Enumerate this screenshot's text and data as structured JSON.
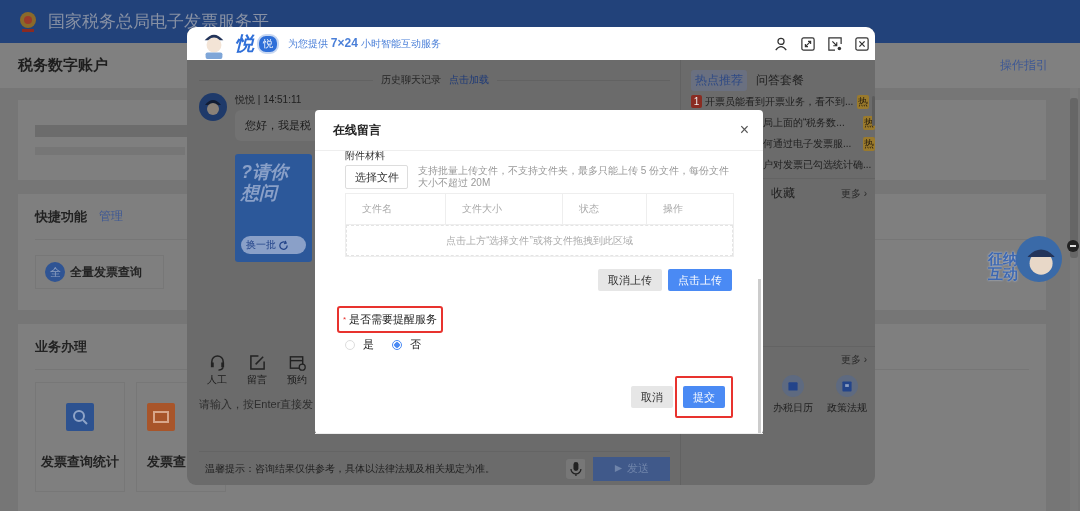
{
  "header": {
    "title": "国家税务总局电子发票服务平"
  },
  "page": {
    "title": "税务数字账户",
    "guide_link": "操作指引",
    "shortcuts": {
      "title": "快捷功能",
      "manage": "管理",
      "items": [
        {
          "badge": "全",
          "label": "全量发票查询"
        }
      ]
    },
    "business": {
      "title": "业务办理",
      "tiles": [
        {
          "kind": "search",
          "label": "发票查询统计"
        },
        {
          "kind": "ticket",
          "label": "发票查"
        }
      ]
    }
  },
  "widget": {
    "label": "征纳互动"
  },
  "chat": {
    "brand": "悦",
    "brand_badge": "悦",
    "tagline": "为您提供 **7×24** 小时智能互动服务",
    "history": "历史聊天记录",
    "load_link": "点击加载",
    "message": {
      "sender": "悦悦 | 14:51:11",
      "text": "您好，我是税"
    },
    "card": {
      "title": "?请你想问",
      "button": "换一批"
    },
    "tools": [
      {
        "kind": "headset",
        "label": "人工"
      },
      {
        "kind": "edit",
        "label": "留言"
      },
      {
        "kind": "calendar",
        "label": "预约"
      }
    ],
    "input_placeholder": "请输入，按Enter直接发",
    "notice": "温馨提示：咨询结果仅供参考，具体以法律法规及相关规定为准。",
    "send": "发送",
    "side": {
      "tabs": [
        {
          "label": "热点推荐",
          "selected": true
        },
        {
          "label": "问答套餐",
          "selected": false
        }
      ],
      "hot": [
        {
          "rank": "1",
          "text": "开票员能看到开票业务，看不到...",
          "tag": "热"
        },
        {
          "text": "局上面的“税务数...",
          "tag": "热"
        },
        {
          "text": "何通过电子发票服...",
          "tag": "热"
        },
        {
          "text": "户对发票已勾选统计确..."
        }
      ],
      "favorites": "收藏",
      "more_1": "更多 ›",
      "more_2": "更多 ›",
      "services": [
        {
          "kind": "calendar",
          "label": "办税日历"
        },
        {
          "kind": "book",
          "label": "政策法规"
        }
      ]
    }
  },
  "modal": {
    "title": "在线留言",
    "close": "×",
    "attach_label": "附件材料",
    "choose": "选择文件",
    "hint": "支持批量上传文件，不支持文件夹，最多只能上传 5 份文件，每份文件大小不超过 20M",
    "columns": [
      "文件名",
      "文件大小",
      "状态",
      "操作"
    ],
    "empty": "点击上方“选择文件”或将文件拖拽到此区域",
    "cancel_upload": "取消上传",
    "upload": "点击上传",
    "reminder": {
      "required_mark": "*",
      "label": "是否需要提醒服务",
      "highlighted": true,
      "options": [
        {
          "label": "是",
          "selected": false
        },
        {
          "label": "否",
          "selected": true
        }
      ]
    },
    "cancel": "取消",
    "submit": "提交",
    "submit_highlighted": true
  }
}
